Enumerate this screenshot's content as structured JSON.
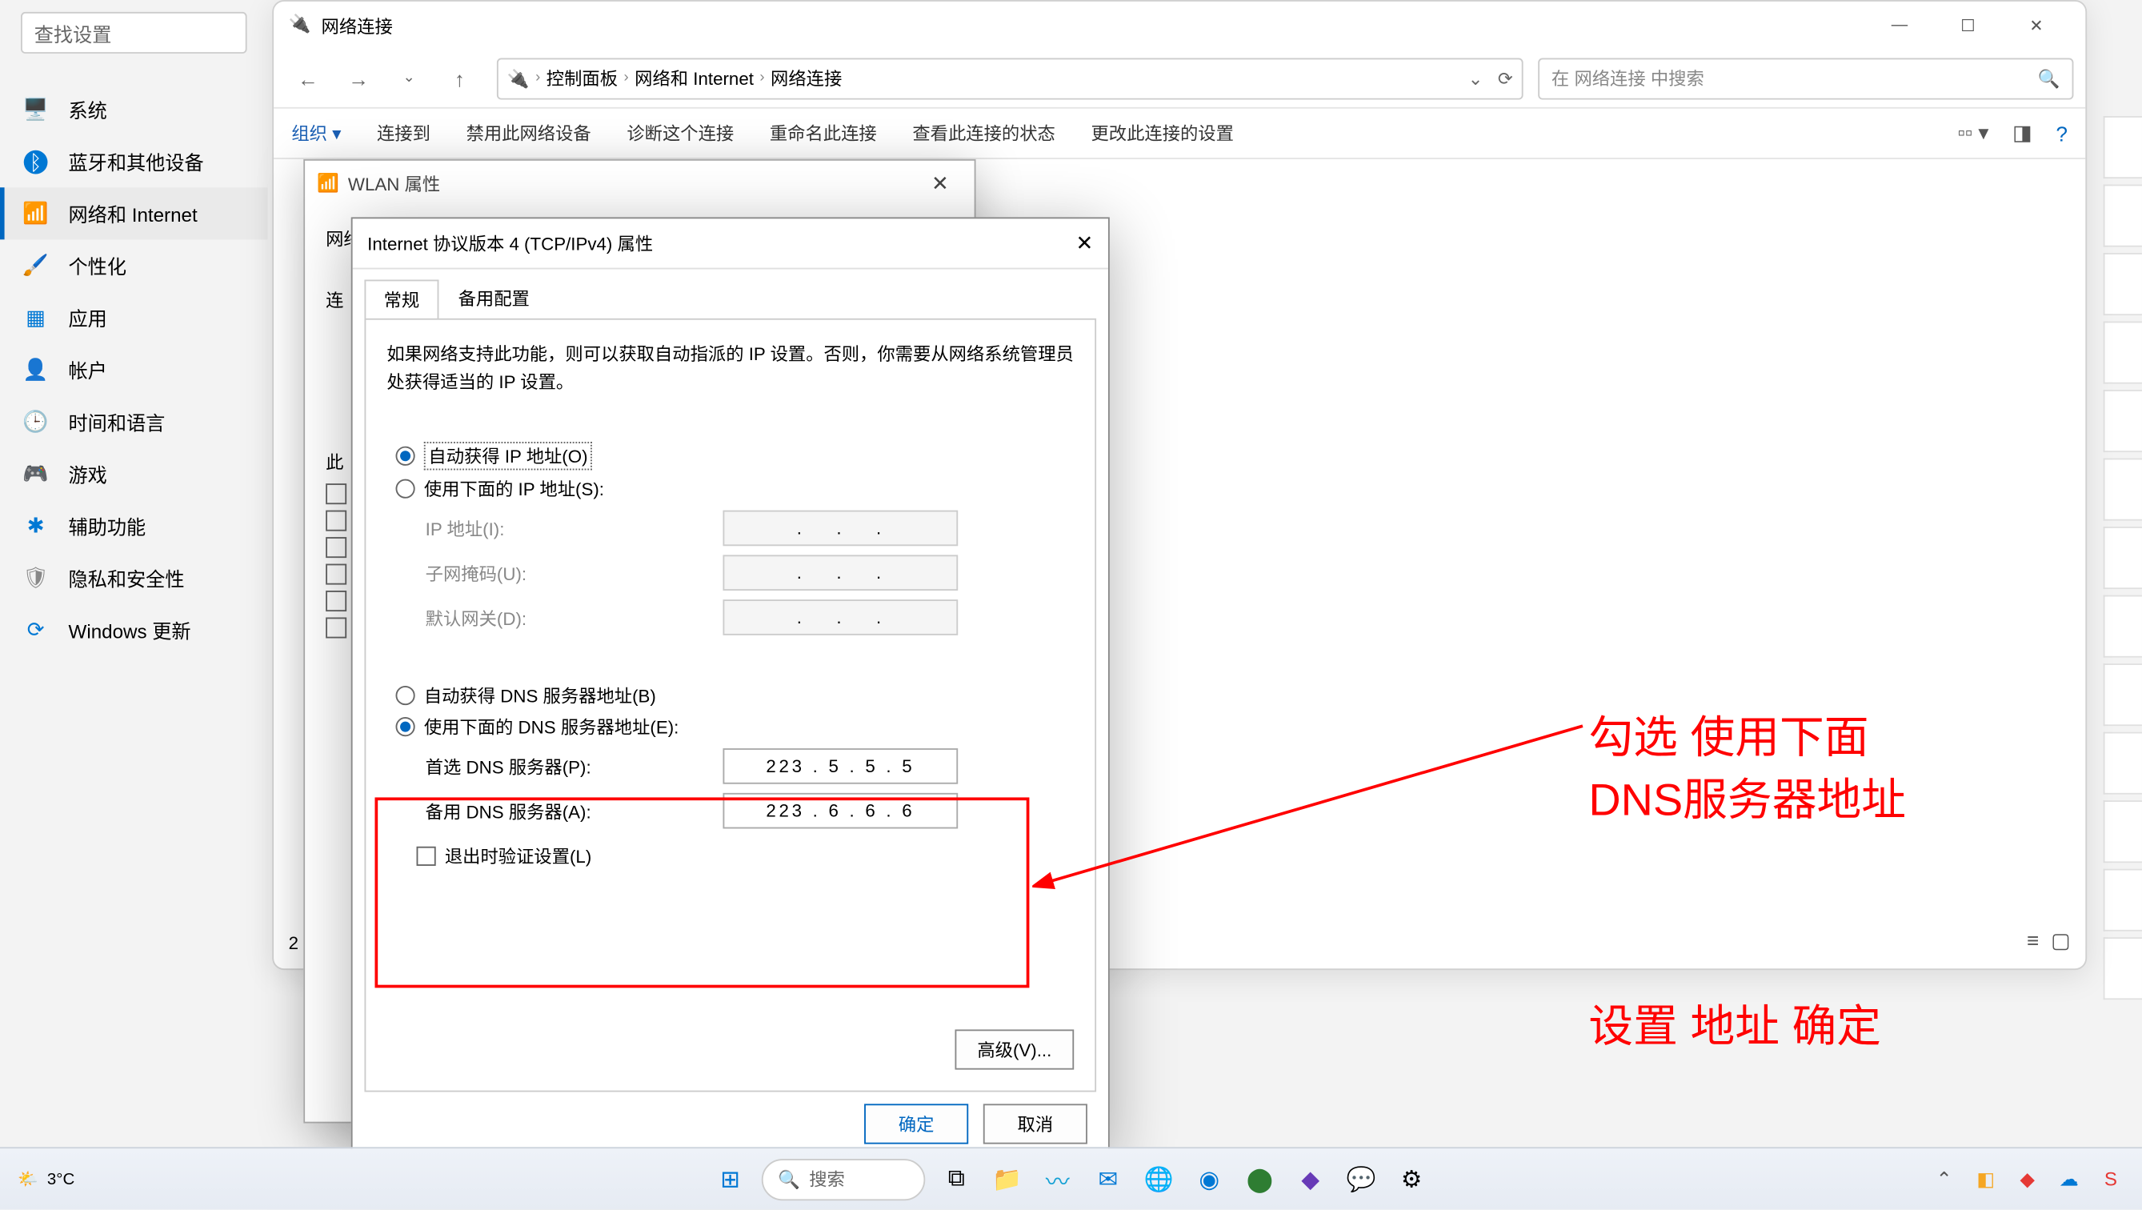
{
  "settings": {
    "search_placeholder": "查找设置",
    "items": [
      {
        "icon": "🖥️",
        "label": "系统",
        "color": "#0078d4"
      },
      {
        "icon": "ᛒ",
        "label": "蓝牙和其他设备",
        "color": "#0078d4",
        "bg": "#0078d4"
      },
      {
        "icon": "📶",
        "label": "网络和 Internet",
        "color": "#0078d4",
        "active": true
      },
      {
        "icon": "🖌️",
        "label": "个性化",
        "color": "#d08a2e"
      },
      {
        "icon": "▦",
        "label": "应用",
        "color": "#0078d4"
      },
      {
        "icon": "👤",
        "label": "帐户",
        "color": "#5b8a3a"
      },
      {
        "icon": "🕒",
        "label": "时间和语言",
        "color": "#0078d4"
      },
      {
        "icon": "🎮",
        "label": "游戏",
        "color": "#888"
      },
      {
        "icon": "✱",
        "label": "辅助功能",
        "color": "#0078d4"
      },
      {
        "icon": "🛡",
        "label": "隐私和安全性",
        "color": "#888"
      },
      {
        "icon": "⟳",
        "label": "Windows 更新",
        "color": "#0078d4"
      }
    ]
  },
  "explorer": {
    "title": "网络连接",
    "breadcrumb": [
      "控制面板",
      "网络和 Internet",
      "网络连接"
    ],
    "search_placeholder": "在 网络连接 中搜索",
    "toolbar": {
      "organize": "组织 ▾",
      "connect": "连接到",
      "disable": "禁用此网络设备",
      "diagnose": "诊断这个连接",
      "rename": "重命名此连接",
      "status": "查看此连接的状态",
      "change": "更改此连接的设置"
    },
    "status_count": "2"
  },
  "wlan": {
    "title": "WLAN 属性",
    "body_prefix": "网络",
    "tab_prefix": "连"
  },
  "ipv4": {
    "title": "Internet 协议版本 4 (TCP/IPv4) 属性",
    "tabs": {
      "general": "常规",
      "alt": "备用配置"
    },
    "description": "如果网络支持此功能，则可以获取自动指派的 IP 设置。否则，你需要从网络系统管理员处获得适当的 IP 设置。",
    "auto_ip": "自动获得 IP 地址(O)",
    "manual_ip": "使用下面的 IP 地址(S):",
    "ip_label": "IP 地址(I):",
    "mask_label": "子网掩码(U):",
    "gw_label": "默认网关(D):",
    "auto_dns": "自动获得 DNS 服务器地址(B)",
    "manual_dns": "使用下面的 DNS 服务器地址(E):",
    "dns1_label": "首选 DNS 服务器(P):",
    "dns2_label": "备用 DNS 服务器(A):",
    "dns1_value": "223 .  5  .  5  .  5",
    "dns2_value": "223 .  6  .  6  .  6",
    "validate": "退出时验证设置(L)",
    "advanced": "高级(V)...",
    "ok": "确定",
    "cancel": "取消"
  },
  "annotation": {
    "line1": "勾选 使用下面",
    "line2": "DNS服务器地址",
    "line3": "设置 地址    确定"
  },
  "taskbar": {
    "temp": "3°C",
    "search": "搜索"
  }
}
